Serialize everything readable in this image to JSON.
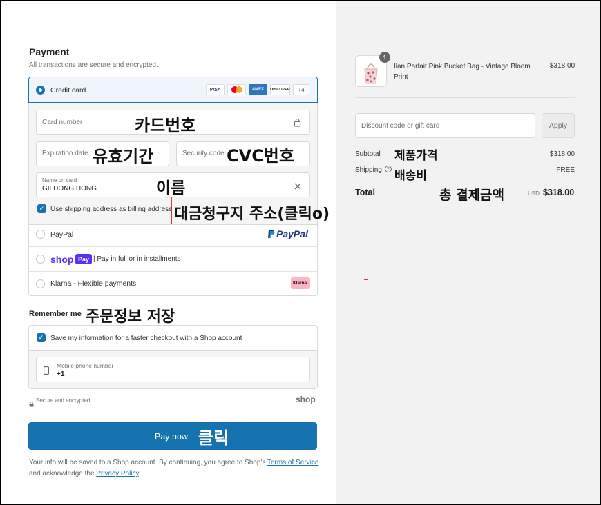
{
  "payment": {
    "title": "Payment",
    "subtitle": "All transactions are secure and encrypted.",
    "credit_card_label": "Credit card",
    "card_brands": [
      "VISA",
      "MC",
      "AMEX",
      "DISCOVER",
      "+4"
    ],
    "card_number_placeholder": "Card number",
    "expiration_placeholder": "Expiration date",
    "security_code_placeholder": "Security code",
    "name_label": "Name on card",
    "name_value": "GILDONG HONG",
    "billing_checkbox_label": "Use shipping address as billing address",
    "paypal_label": "PayPal",
    "paypal_logo": "PayPal",
    "shop_logo": "shop",
    "shop_pay_tag": "Pay",
    "shop_pay_text": "| Pay in full or in installments",
    "klarna_label": "Klarna - Flexible payments",
    "klarna_badge": "Klarna."
  },
  "remember": {
    "title": "Remember me",
    "save_label": "Save my information for a faster checkout with a Shop account",
    "phone_label": "Mobile phone number",
    "phone_value": "+1",
    "secure_text": "Secure and encrypted",
    "shop_brand": "shop"
  },
  "pay_button": "Pay now",
  "footer": {
    "text_before": "Your info will be saved to a Shop account. By continuing, you agree to Shop's ",
    "terms_link": "Terms of Service",
    "text_middle": " and acknowledge the ",
    "privacy_link": "Privacy Policy",
    "text_end": "."
  },
  "order": {
    "product_name": "Ilan Parfait Pink Bucket Bag - Vintage Bloom Print",
    "product_price": "$318.00",
    "quantity": "1",
    "discount_placeholder": "Discount code or gift card",
    "apply_label": "Apply",
    "subtotal_label": "Subtotal",
    "subtotal_value": "$318.00",
    "shipping_label": "Shipping",
    "shipping_value": "FREE",
    "total_label": "Total",
    "total_currency": "USD",
    "total_value": "$318.00"
  },
  "annotations": {
    "card_number": "카드번호",
    "expiration": "유효기간",
    "cvc": "CVC번호",
    "name": "이름",
    "billing": "대금청구지 주소(클릭o)",
    "remember": "주문정보 저장",
    "pay_click": "클릭",
    "product_price": "제품가격",
    "shipping_fee": "배송비",
    "total": "총 결제금액"
  },
  "colors": {
    "accent": "#1773b0",
    "highlight_border": "#d03b3b",
    "shop_purple": "#5a31f4",
    "klarna_pink": "#ffb3c7"
  },
  "icons": [
    "lock-icon",
    "clear-icon",
    "check-icon",
    "phone-icon",
    "help-icon",
    "paypal-icon"
  ]
}
